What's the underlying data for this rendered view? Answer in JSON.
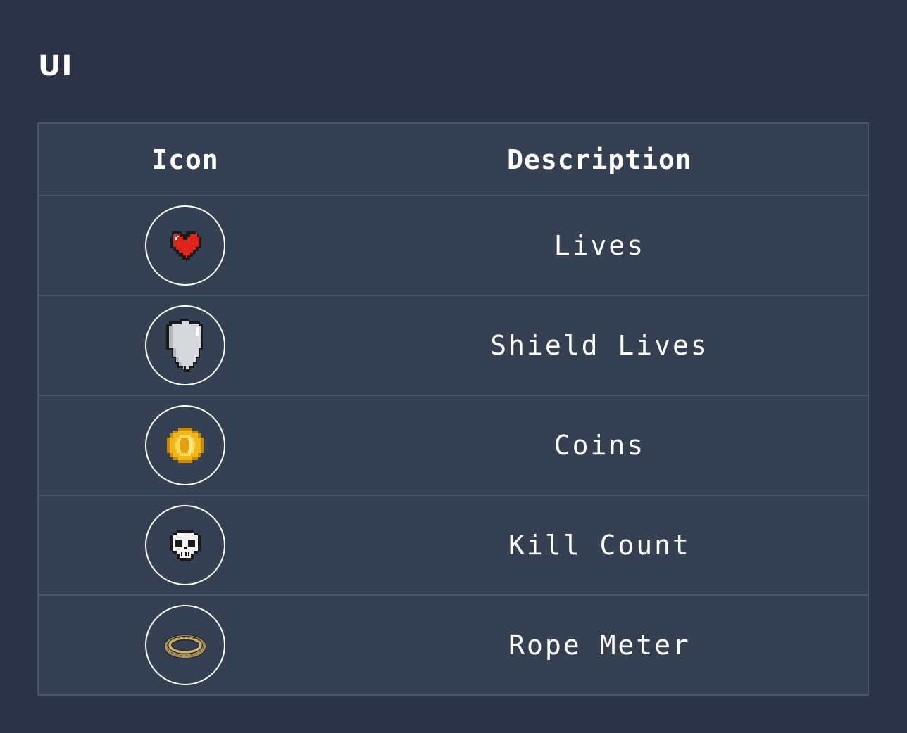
{
  "page": {
    "title": "UI"
  },
  "table": {
    "headers": {
      "icon": "Icon",
      "description": "Description"
    },
    "rows": [
      {
        "icon": "heart-icon",
        "description": "Lives"
      },
      {
        "icon": "shield-icon",
        "description": "Shield Lives"
      },
      {
        "icon": "coin-icon",
        "description": "Coins"
      },
      {
        "icon": "skull-icon",
        "description": "Kill Count"
      },
      {
        "icon": "rope-icon",
        "description": "Rope Meter"
      }
    ]
  },
  "colors": {
    "background": "#2c3346",
    "table_background": "#364053",
    "grid_line": "#4a5467",
    "text": "#ffffff",
    "heart_red": "#e0241b",
    "shield_silver": "#d6d8dc",
    "coin_gold": "#f2b619",
    "rope_tan": "#a89262"
  }
}
